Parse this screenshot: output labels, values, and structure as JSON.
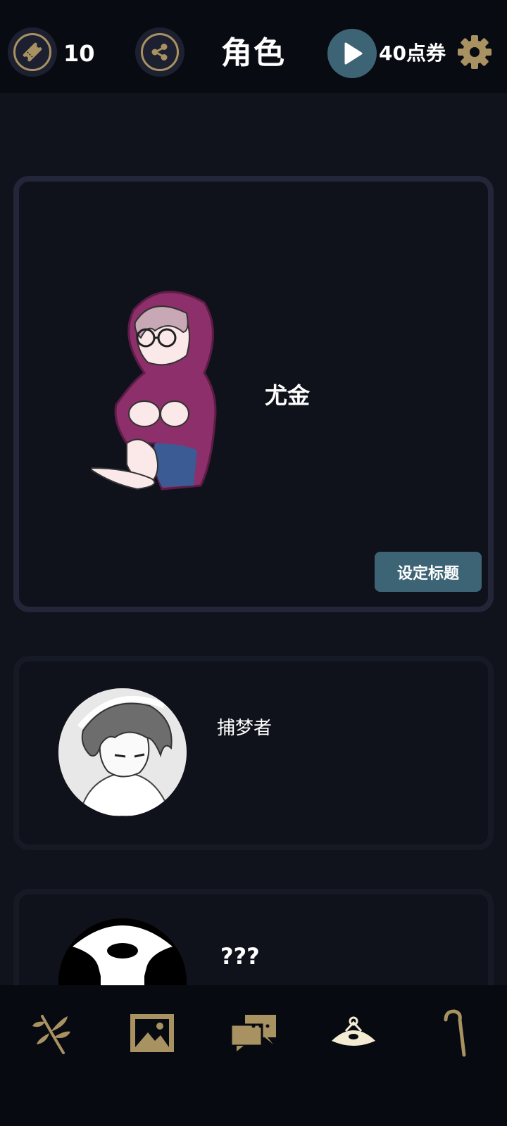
{
  "header": {
    "ticket_icon": "ticket-icon",
    "ticket_count": "10",
    "share_icon": "share-icon",
    "title": "角色",
    "play_icon": "play-icon",
    "points": "40点券",
    "settings_icon": "gear-icon"
  },
  "colors": {
    "gold": "#a89261",
    "teal": "#3d6475",
    "background": "#10131c",
    "topbar": "#090b12"
  },
  "characters": [
    {
      "name": "尤金",
      "selected": true,
      "action_label": "设定标题"
    },
    {
      "name": "捕梦者",
      "selected": false
    },
    {
      "name": "???",
      "selected": false,
      "locked": true
    }
  ],
  "nav": [
    {
      "icon": "branch-icon"
    },
    {
      "icon": "gallery-icon"
    },
    {
      "icon": "chat-icon"
    },
    {
      "icon": "character-fan-icon",
      "active": true
    },
    {
      "icon": "cane-icon"
    }
  ]
}
